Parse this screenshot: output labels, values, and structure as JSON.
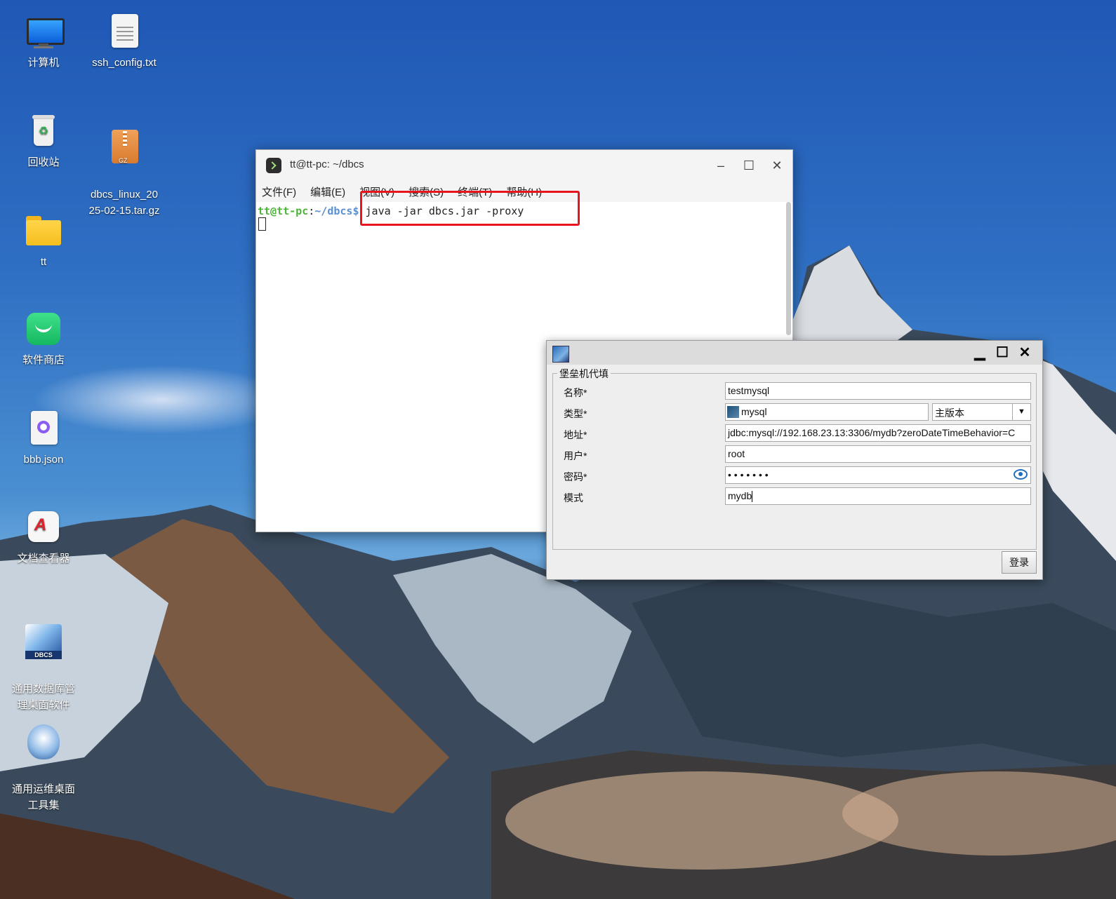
{
  "desktop": {
    "icons": [
      {
        "label": "计算机"
      },
      {
        "label": "ssh_config.txt"
      },
      {
        "label": "回收站"
      },
      {
        "label": "dbcs_linux_20\n25-02-15.tar.gz"
      },
      {
        "label": "tt"
      },
      {
        "label": "软件商店"
      },
      {
        "label": "bbb.json"
      },
      {
        "label": "文档查看器"
      },
      {
        "label": "通用数据库管\n理桌面软件"
      },
      {
        "label": "通用运维桌面\n工具集"
      }
    ]
  },
  "terminal": {
    "title": "tt@tt-pc: ~/dbcs",
    "menu": [
      "文件(F)",
      "编辑(E)",
      "视图(V)",
      "搜索(S)",
      "终端(T)",
      "帮助(H)"
    ],
    "prompt_user": "tt@tt-pc",
    "prompt_sep": ":",
    "prompt_path": "~/dbcs$",
    "command": " java -jar dbcs.jar -proxy",
    "highlight_color": "#e8141e"
  },
  "dialog": {
    "group_title": "堡垒机代填",
    "fields": {
      "name_label": "名称*",
      "name_value": "testmysql",
      "type_label": "类型*",
      "type_value": "mysql",
      "version_value": "主版本",
      "address_label": "地址*",
      "address_value": "jdbc:mysql://192.168.23.13:3306/mydb?zeroDateTimeBehavior=C",
      "user_label": "用户*",
      "user_value": "root",
      "password_label": "密码*",
      "password_value": "• • • • • • •",
      "schema_label": "模式",
      "schema_value": "mydb"
    },
    "login_label": "登录"
  }
}
